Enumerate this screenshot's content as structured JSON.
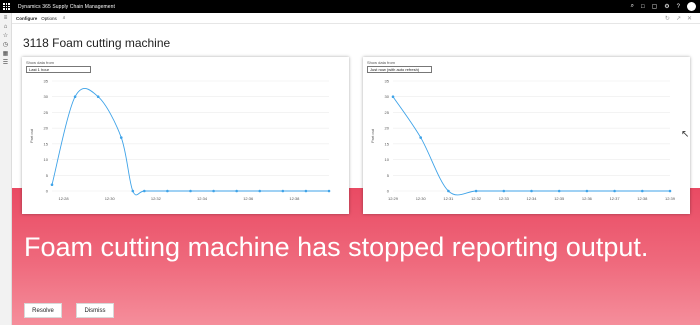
{
  "app": {
    "title": "Dynamics 365 Supply Chain Management"
  },
  "topbar_icons": [
    "search-icon",
    "bell-icon",
    "chat-icon",
    "gear-icon",
    "help-icon",
    "avatar"
  ],
  "command_bar": {
    "items": [
      "Configure",
      "Options"
    ],
    "search_icon": "search-icon"
  },
  "page": {
    "title": "3118 Foam cutting machine"
  },
  "alert": {
    "message": "Foam cutting machine has stopped reporting output.",
    "resolve_label": "Resolve",
    "dismiss_label": "Dismiss",
    "banner_color": "#e94a63"
  },
  "charts_ui": [
    {
      "filter_label": "Show data from",
      "filter_value": "Last 1 hour"
    },
    {
      "filter_label": "Show data from",
      "filter_value": "Just now (with auto refresh)"
    }
  ],
  "chart_data": [
    {
      "type": "line",
      "ylabel": "Part out",
      "ylim": [
        0,
        35
      ],
      "yticks": [
        0,
        5,
        10,
        15,
        20,
        25,
        30,
        35
      ],
      "x_ticks": [
        "12:28",
        "12:30",
        "12:32",
        "12:34",
        "12:36",
        "12:38"
      ],
      "x_ticks_pos": [
        1,
        5,
        9,
        13,
        17,
        21
      ],
      "x_range": [
        0,
        24
      ],
      "points_x": [
        0,
        2,
        4,
        6,
        7,
        8,
        10,
        12,
        14,
        16,
        18,
        20,
        22,
        24
      ],
      "points_y": [
        2,
        30,
        30,
        17,
        0,
        0,
        0,
        0,
        0,
        0,
        0,
        0,
        0,
        0
      ],
      "color": "#3fa3e8"
    },
    {
      "type": "line",
      "ylabel": "Part out",
      "ylim": [
        0,
        35
      ],
      "yticks": [
        0,
        5,
        10,
        15,
        20,
        25,
        30,
        35
      ],
      "x_ticks": [
        "12:29",
        "12:30",
        "12:31",
        "12:32",
        "12:33",
        "12:34",
        "12:35",
        "12:36",
        "12:37",
        "12:38",
        "12:39"
      ],
      "x_ticks_pos": [
        0,
        1,
        2,
        3,
        4,
        5,
        6,
        7,
        8,
        9,
        10
      ],
      "x_range": [
        0,
        10
      ],
      "points_x": [
        0,
        1,
        2,
        3,
        4,
        5,
        6,
        7,
        8,
        9,
        10
      ],
      "points_y": [
        30,
        17,
        0,
        0,
        0,
        0,
        0,
        0,
        0,
        0,
        0
      ],
      "color": "#3fa3e8"
    }
  ]
}
